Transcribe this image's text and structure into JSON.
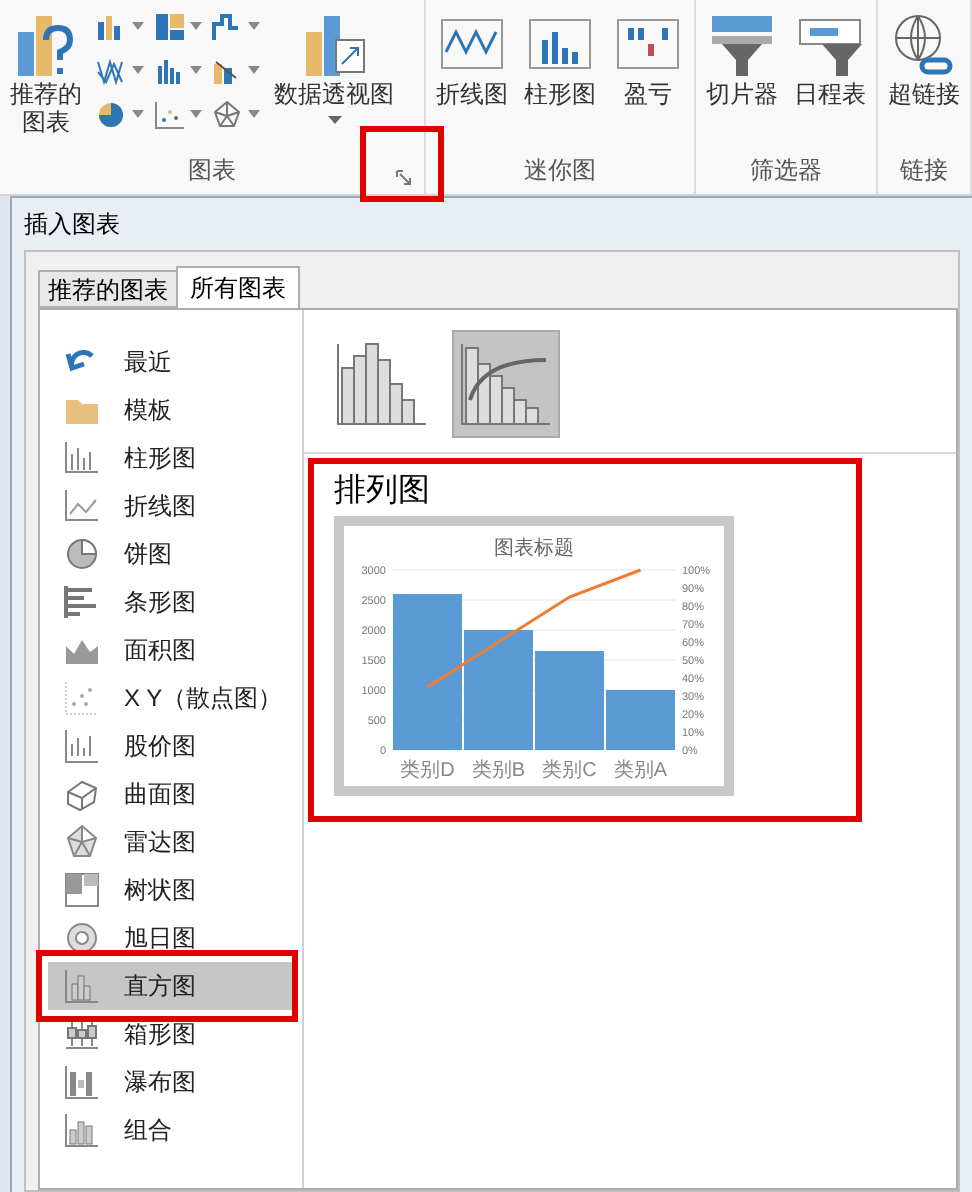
{
  "ribbon": {
    "groups": [
      {
        "label": "图表",
        "launcher": {
          "highlighted": true
        },
        "big_buttons": [
          {
            "label_lines": [
              "推荐的",
              "图表"
            ],
            "dropdown": false
          },
          {
            "label": "数据透视图",
            "dropdown": true
          }
        ],
        "small_buttons": [
          {
            "dropdown": true
          },
          {
            "dropdown": true
          },
          {
            "dropdown": true
          },
          {
            "dropdown": true
          },
          {
            "dropdown": true
          },
          {
            "dropdown": true
          },
          {
            "dropdown": true
          },
          {
            "dropdown": true
          },
          {
            "dropdown": true
          }
        ]
      },
      {
        "label": "迷你图",
        "big_buttons": [
          {
            "label": "折线图",
            "dropdown": false
          },
          {
            "label": "柱形图",
            "dropdown": false
          },
          {
            "label": "盈亏",
            "dropdown": false
          }
        ]
      },
      {
        "label": "筛选器",
        "big_buttons": [
          {
            "label": "切片器",
            "dropdown": false
          },
          {
            "label": "日程表",
            "dropdown": false
          }
        ]
      },
      {
        "label": "链接",
        "big_buttons": [
          {
            "label": "超链接",
            "dropdown": false
          }
        ]
      }
    ]
  },
  "dialog": {
    "title": "插入图表",
    "tabs": [
      {
        "label": "推荐的图表",
        "selected": false
      },
      {
        "label": "所有图表",
        "selected": true
      }
    ],
    "chart_types": [
      {
        "label": "最近",
        "selected": false,
        "highlighted": false
      },
      {
        "label": "模板",
        "selected": false,
        "highlighted": false
      },
      {
        "label": "柱形图",
        "selected": false,
        "highlighted": false
      },
      {
        "label": "折线图",
        "selected": false,
        "highlighted": false
      },
      {
        "label": "饼图",
        "selected": false,
        "highlighted": false
      },
      {
        "label": "条形图",
        "selected": false,
        "highlighted": false
      },
      {
        "label": "面积图",
        "selected": false,
        "highlighted": false
      },
      {
        "label": "X Y（散点图）",
        "selected": false,
        "highlighted": false
      },
      {
        "label": "股价图",
        "selected": false,
        "highlighted": false
      },
      {
        "label": "曲面图",
        "selected": false,
        "highlighted": false
      },
      {
        "label": "雷达图",
        "selected": false,
        "highlighted": false
      },
      {
        "label": "树状图",
        "selected": false,
        "highlighted": false
      },
      {
        "label": "旭日图",
        "selected": false,
        "highlighted": false
      },
      {
        "label": "直方图",
        "selected": true,
        "highlighted": true
      },
      {
        "label": "箱形图",
        "selected": false,
        "highlighted": false
      },
      {
        "label": "瀑布图",
        "selected": false,
        "highlighted": false
      },
      {
        "label": "组合",
        "selected": false,
        "highlighted": false
      }
    ],
    "subtypes": [
      {
        "selected": false
      },
      {
        "selected": true
      }
    ],
    "preview": {
      "title": "排列图",
      "highlighted": true,
      "chart_data": {
        "type": "bar",
        "title": "图表标题",
        "categories": [
          "类别D",
          "类别B",
          "类别C",
          "类别A"
        ],
        "series": [
          {
            "type": "bar",
            "color": "#5b9bd5",
            "values": [
              2600,
              2000,
              1650,
              1000
            ]
          },
          {
            "type": "line",
            "color": "#ed7d31",
            "values": [
              1050,
              1800,
              2550,
              3000
            ]
          }
        ],
        "grid": true,
        "ylim": [
          0,
          3000
        ],
        "yticks": [
          0,
          500,
          1000,
          1500,
          2000,
          2500,
          3000
        ],
        "y2ticks": [
          "0%",
          "10%",
          "20%",
          "30%",
          "40%",
          "50%",
          "60%",
          "70%",
          "80%",
          "90%",
          "100%"
        ]
      }
    }
  }
}
